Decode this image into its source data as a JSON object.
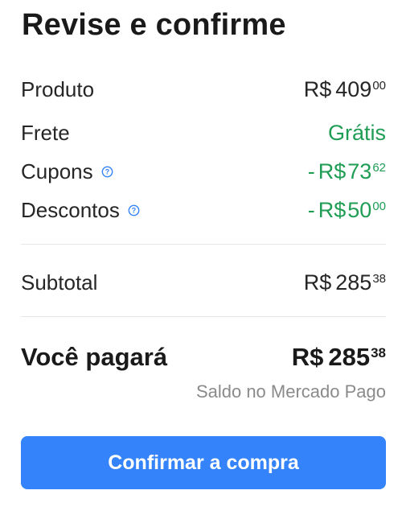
{
  "title": "Revise e confirme",
  "rows": [
    {
      "label": "Produto",
      "prefix": "",
      "currency": "R$",
      "amount": "409",
      "cents": "00"
    },
    {
      "label": "Frete",
      "value": "Grátis"
    },
    {
      "label": "Cupons",
      "prefix": "-",
      "currency": "R$",
      "amount": "73",
      "cents": "62"
    },
    {
      "label": "Descontos",
      "prefix": "-",
      "currency": "R$",
      "amount": "50",
      "cents": "00"
    }
  ],
  "subtotal": {
    "label": "Subtotal",
    "currency": "R$",
    "amount": "285",
    "cents": "38"
  },
  "total": {
    "label": "Você pagará",
    "currency": "R$",
    "amount": "285",
    "cents": "38",
    "note": "Saldo no Mercado Pago"
  },
  "button": {
    "label": "Confirmar a compra"
  },
  "colors": {
    "accent": "#3483fa",
    "discount": "#1f9d55",
    "info_icon": "#3483fa"
  },
  "icons": {
    "info": "question-circle-icon"
  }
}
